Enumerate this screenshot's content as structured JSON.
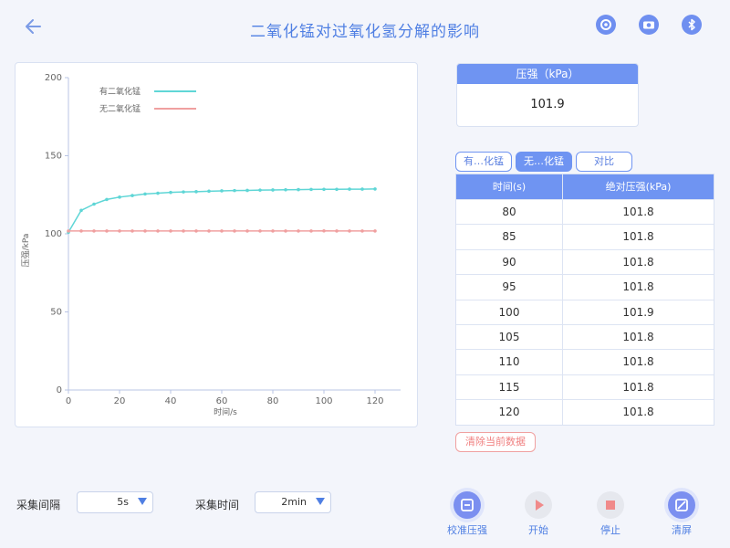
{
  "header": {
    "title": "二氧化锰对过氧化氢分解的影响"
  },
  "chart_data": {
    "type": "line",
    "xlabel": "时间/s",
    "ylabel": "压强/kPa",
    "xlim": [
      0,
      130
    ],
    "ylim": [
      0,
      200
    ],
    "xticks": [
      0,
      20,
      40,
      60,
      80,
      100,
      120
    ],
    "yticks": [
      0,
      50,
      100,
      150,
      200
    ],
    "legend_position": "top-left",
    "series": [
      {
        "name": "有二氧化锰",
        "color": "#5fd6d6",
        "x": [
          0,
          5,
          10,
          15,
          20,
          25,
          30,
          35,
          40,
          45,
          50,
          55,
          60,
          65,
          70,
          75,
          80,
          85,
          90,
          95,
          100,
          105,
          110,
          115,
          120
        ],
        "y": [
          101,
          115,
          119,
          122,
          123.5,
          124.5,
          125.5,
          126,
          126.5,
          126.8,
          127,
          127.3,
          127.5,
          127.7,
          127.8,
          128,
          128.1,
          128.2,
          128.3,
          128.4,
          128.5,
          128.5,
          128.6,
          128.6,
          128.7
        ]
      },
      {
        "name": "无二氧化锰",
        "color": "#f0a0a0",
        "x": [
          0,
          5,
          10,
          15,
          20,
          25,
          30,
          35,
          40,
          45,
          50,
          55,
          60,
          65,
          70,
          75,
          80,
          85,
          90,
          95,
          100,
          105,
          110,
          115,
          120
        ],
        "y": [
          101.8,
          101.8,
          101.8,
          101.8,
          101.8,
          101.8,
          101.8,
          101.8,
          101.8,
          101.8,
          101.8,
          101.8,
          101.8,
          101.8,
          101.8,
          101.8,
          101.8,
          101.8,
          101.8,
          101.8,
          101.9,
          101.8,
          101.8,
          101.8,
          101.8
        ]
      }
    ]
  },
  "pressure": {
    "label": "压强（kPa）",
    "value": "101.9"
  },
  "tabs": [
    {
      "label": "有…化锰",
      "active": false
    },
    {
      "label": "无…化锰",
      "active": true
    },
    {
      "label": "对比",
      "active": false
    }
  ],
  "table": {
    "col1": "时间(s)",
    "col2": "绝对压强(kPa)",
    "rows": [
      [
        "80",
        "101.8"
      ],
      [
        "85",
        "101.8"
      ],
      [
        "90",
        "101.8"
      ],
      [
        "95",
        "101.8"
      ],
      [
        "100",
        "101.9"
      ],
      [
        "105",
        "101.8"
      ],
      [
        "110",
        "101.8"
      ],
      [
        "115",
        "101.8"
      ],
      [
        "120",
        "101.8"
      ]
    ]
  },
  "clear_data_label": "清除当前数据",
  "controls": {
    "interval_label": "采集间隔",
    "interval_value": "5s",
    "duration_label": "采集时间",
    "duration_value": "2min"
  },
  "actions": {
    "calibrate": "校准压强",
    "start": "开始",
    "stop": "停止",
    "clear_screen": "清屏"
  },
  "colors": {
    "accent": "#4f7fe3",
    "calibrate": "#7b8ff0",
    "start": "#f08a8a",
    "stop": "#f08a8a",
    "clear_screen": "#7b8ff0"
  },
  "icons": {
    "back": "arrow-left-icon",
    "settings": "gear-icon",
    "camera": "camera-icon",
    "bluetooth": "bluetooth-icon"
  }
}
